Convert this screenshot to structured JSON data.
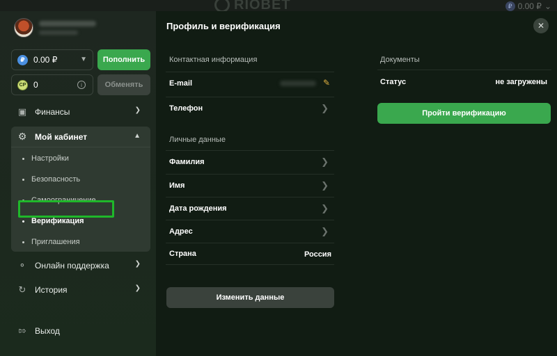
{
  "background": {
    "logo_text": "RIOBET",
    "balance": "0.00 ₽"
  },
  "sidebar": {
    "balance_value": "0.00 ₽",
    "rub_symbol": "₽",
    "cp_value": "0",
    "cp_symbol": "CP",
    "deposit_label": "Пополнить",
    "exchange_label": "Обменять",
    "nav": {
      "finance": "Финансы",
      "cabinet": "Мой кабинет",
      "support": "Онлайн поддержка",
      "history": "История",
      "logout": "Выход"
    },
    "cabinet_items": [
      {
        "label": "Настройки"
      },
      {
        "label": "Безопасность"
      },
      {
        "label": "Самоограничение"
      },
      {
        "label": "Верификация"
      },
      {
        "label": "Приглашения"
      }
    ]
  },
  "main": {
    "title": "Профиль и верификация",
    "contact_section": "Контактная информация",
    "personal_section": "Личные данные",
    "documents_section": "Документы",
    "contact_rows": [
      {
        "label": "E-mail"
      },
      {
        "label": "Телефон"
      }
    ],
    "personal_rows": [
      {
        "label": "Фамилия"
      },
      {
        "label": "Имя"
      },
      {
        "label": "Дата рождения"
      },
      {
        "label": "Адрес"
      },
      {
        "label": "Страна",
        "value": "Россия"
      }
    ],
    "documents": {
      "status_label": "Статус",
      "status_value": "не загружены"
    },
    "verify_button": "Пройти верификацию",
    "change_button": "Изменить данные"
  },
  "colors": {
    "accent_green": "#3aa84e",
    "highlight_green": "#1fb82a",
    "pencil_yellow": "#e0b040"
  }
}
